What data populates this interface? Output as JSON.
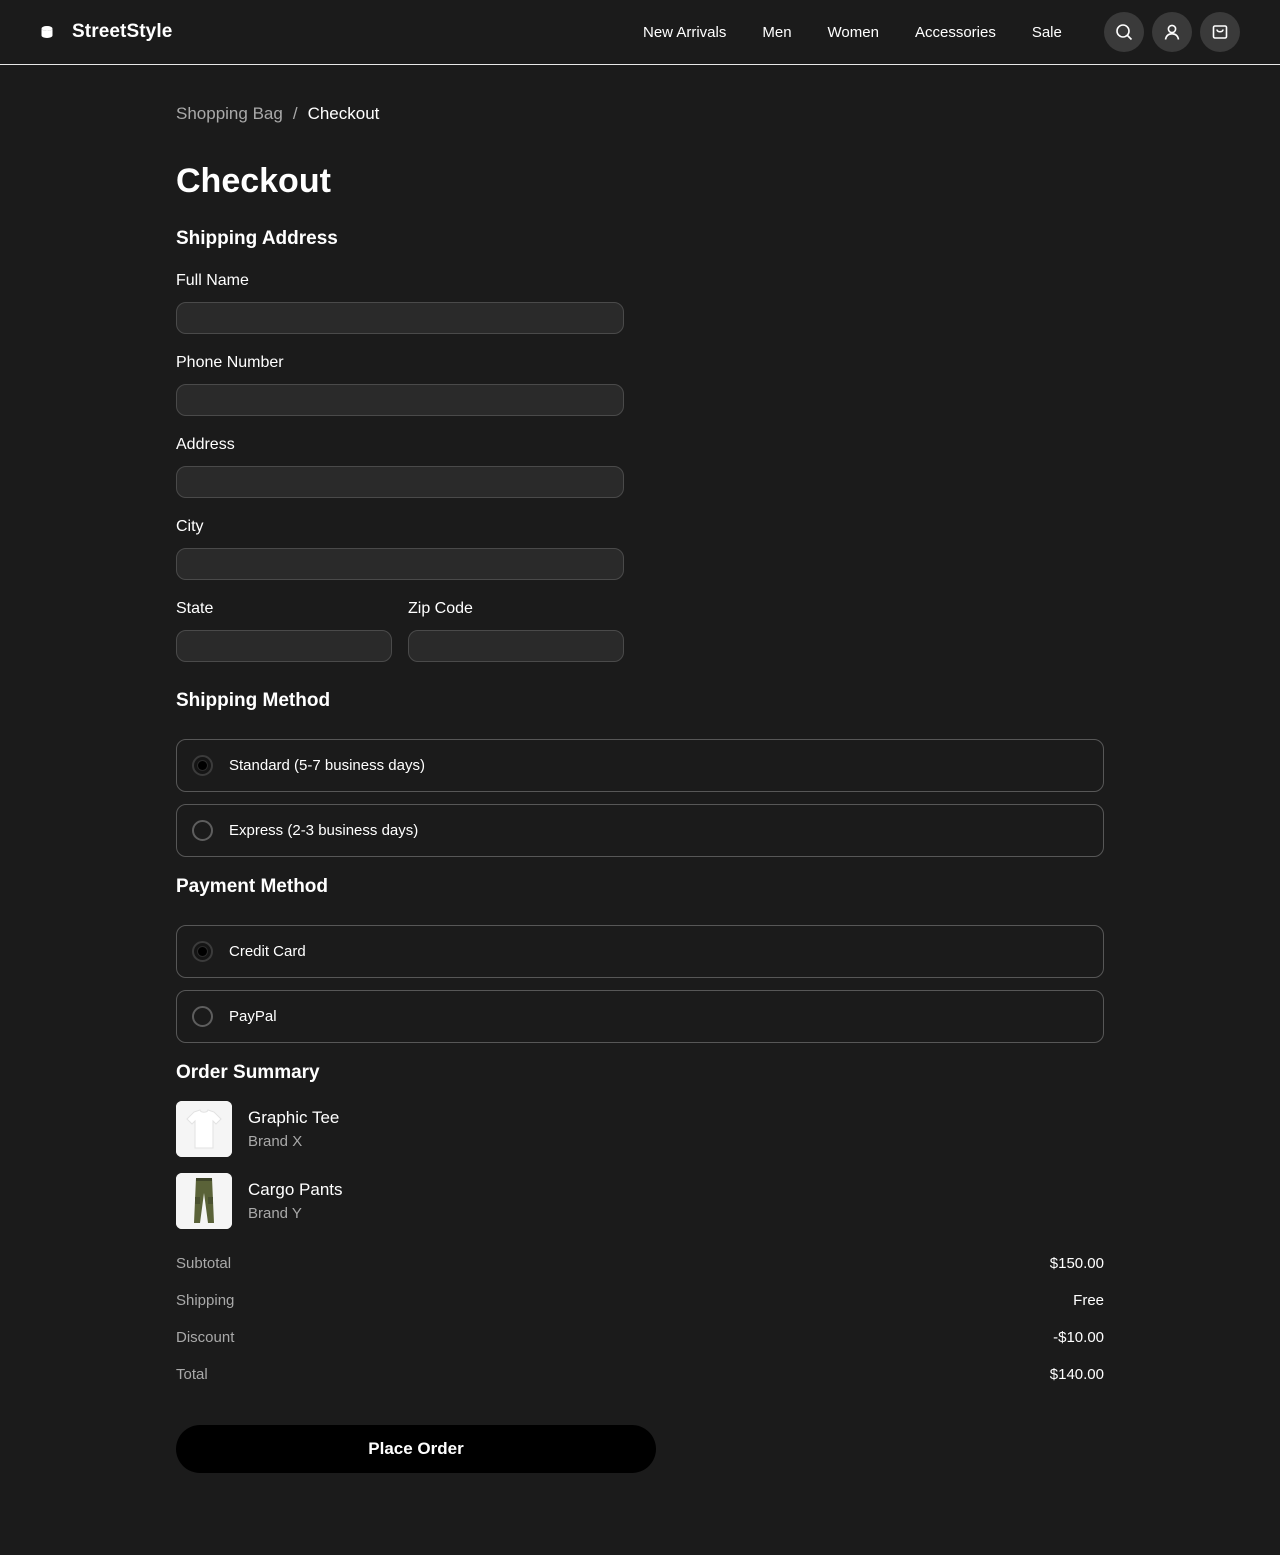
{
  "header": {
    "brand": "StreetStyle",
    "nav": [
      "New Arrivals",
      "Men",
      "Women",
      "Accessories",
      "Sale"
    ],
    "icons": [
      "search-icon",
      "user-icon",
      "cart-icon"
    ]
  },
  "breadcrumb": {
    "parent": "Shopping Bag",
    "separator": "/",
    "current": "Checkout"
  },
  "page_title": "Checkout",
  "shipping_address": {
    "title": "Shipping Address",
    "full_name": {
      "label": "Full Name",
      "value": ""
    },
    "phone": {
      "label": "Phone Number",
      "value": ""
    },
    "address": {
      "label": "Address",
      "value": ""
    },
    "city": {
      "label": "City",
      "value": ""
    },
    "state": {
      "label": "State",
      "value": ""
    },
    "zip": {
      "label": "Zip Code",
      "value": ""
    }
  },
  "shipping_method": {
    "title": "Shipping Method",
    "options": [
      {
        "label": "Standard (5-7 business days)",
        "selected": true
      },
      {
        "label": "Express (2-3 business days)",
        "selected": false
      }
    ]
  },
  "payment_method": {
    "title": "Payment Method",
    "options": [
      {
        "label": "Credit Card",
        "selected": true
      },
      {
        "label": "PayPal",
        "selected": false
      }
    ]
  },
  "order_summary": {
    "title": "Order Summary",
    "items": [
      {
        "name": "Graphic Tee",
        "brand": "Brand X"
      },
      {
        "name": "Cargo Pants",
        "brand": "Brand Y"
      }
    ],
    "subtotal": {
      "label": "Subtotal",
      "value": "$150.00"
    },
    "shipping": {
      "label": "Shipping",
      "value": "Free"
    },
    "discount": {
      "label": "Discount",
      "value": "-$10.00"
    },
    "total": {
      "label": "Total",
      "value": "$140.00"
    }
  },
  "place_order_label": "Place Order",
  "colors": {
    "background": "#1b1b1b",
    "button": "#000000",
    "muted_text": "#a9a9a9"
  }
}
